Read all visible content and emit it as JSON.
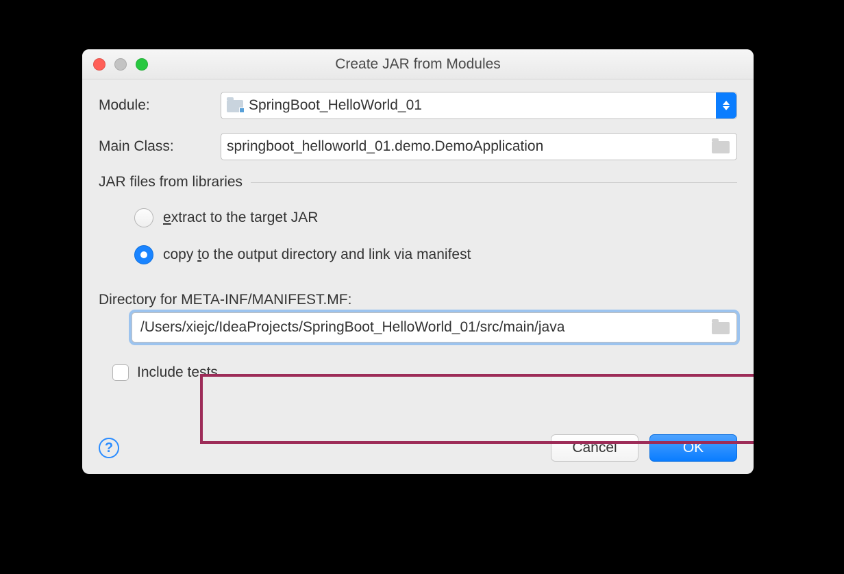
{
  "title": "Create JAR from Modules",
  "labels": {
    "module": "Module:",
    "mainClass": "Main Class:",
    "group": "JAR files from libraries",
    "radioExtractPre": "e",
    "radioExtractPost": "xtract to the target JAR",
    "radioCopyPre": "copy ",
    "radioCopyUnder": "t",
    "radioCopyPost": "o the output directory and link via manifest",
    "dirLabel": "Directory for META-INF/MANIFEST.MF:",
    "includeTests": "Include tests"
  },
  "values": {
    "module": "SpringBoot_HelloWorld_01",
    "mainClass": "springboot_helloworld_01.demo.DemoApplication",
    "manifestDir": "/Users/xiejc/IdeaProjects/SpringBoot_HelloWorld_01/src/main/java"
  },
  "buttons": {
    "cancel": "Cancel",
    "ok": "OK"
  }
}
